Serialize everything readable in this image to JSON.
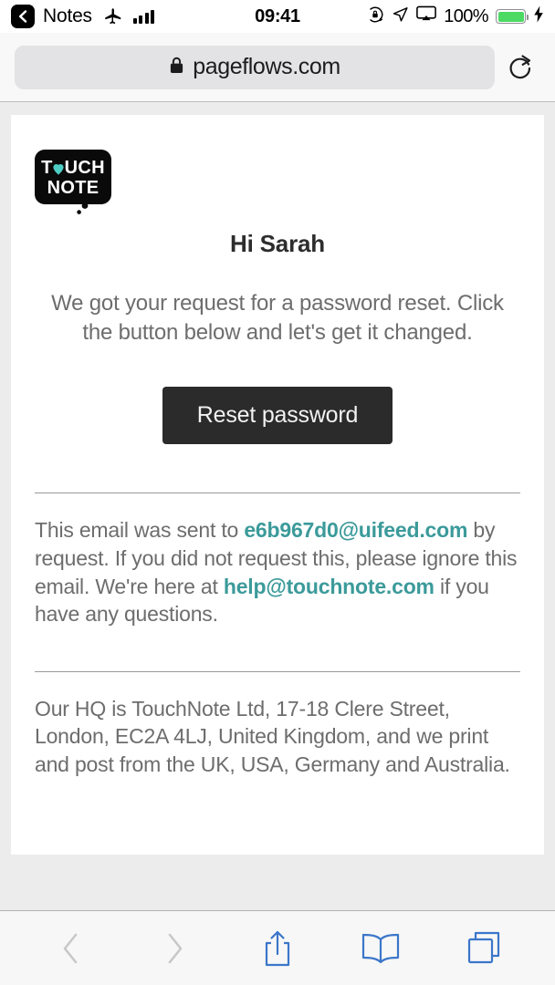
{
  "status_bar": {
    "back_app_label": "Notes",
    "back_icon": "back-chevron-icon",
    "airplane_icon": "airplane-mode-icon",
    "signal_icon": "cellular-signal-icon",
    "time": "09:41",
    "rotation_lock_icon": "rotation-lock-icon",
    "location_icon": "location-arrow-icon",
    "airplay_icon": "screen-mirroring-icon",
    "battery_percent": "100%",
    "battery_icon": "battery-full-icon",
    "charging_icon": "lightning-bolt-icon",
    "battery_color": "#4cd964"
  },
  "browser": {
    "lock_icon": "lock-icon",
    "url": "pageflows.com",
    "reload_icon": "reload-icon",
    "back_icon": "chevron-left-icon",
    "forward_icon": "chevron-right-icon",
    "share_icon": "share-icon",
    "bookmarks_icon": "book-icon",
    "tabs_icon": "tabs-icon",
    "nav_enabled_color": "#3b76c9",
    "nav_disabled_color": "#c8c8c8"
  },
  "email": {
    "logo": {
      "name": "touchnote-logo",
      "line1_before": "T",
      "line1_heart": "heart-icon",
      "line1_after": "UCH",
      "line2": "NOTE",
      "heart_color": "#4ecdc4",
      "bubble_color": "#0a0a0a"
    },
    "greeting": "Hi Sarah",
    "lead": "We got your request for a password reset. Click the button below and let's get it changed.",
    "cta_label": "Reset password",
    "cta_color": "#2b2b2b",
    "notice": {
      "part1": "This email was sent to ",
      "link1": "e6b967d0@uifeed.com",
      "part2": " by request. If you did not request this, please ignore this email. We're here at ",
      "link2": "help@touchnote.com",
      "part3": " if you have any questions."
    },
    "address": "Our HQ is TouchNote Ltd, 17-18 Clere Street, London, EC2A 4LJ, United Kingdom, and we print and post from the UK, USA, Germany and Australia.",
    "link_color": "#3c9a9a"
  }
}
